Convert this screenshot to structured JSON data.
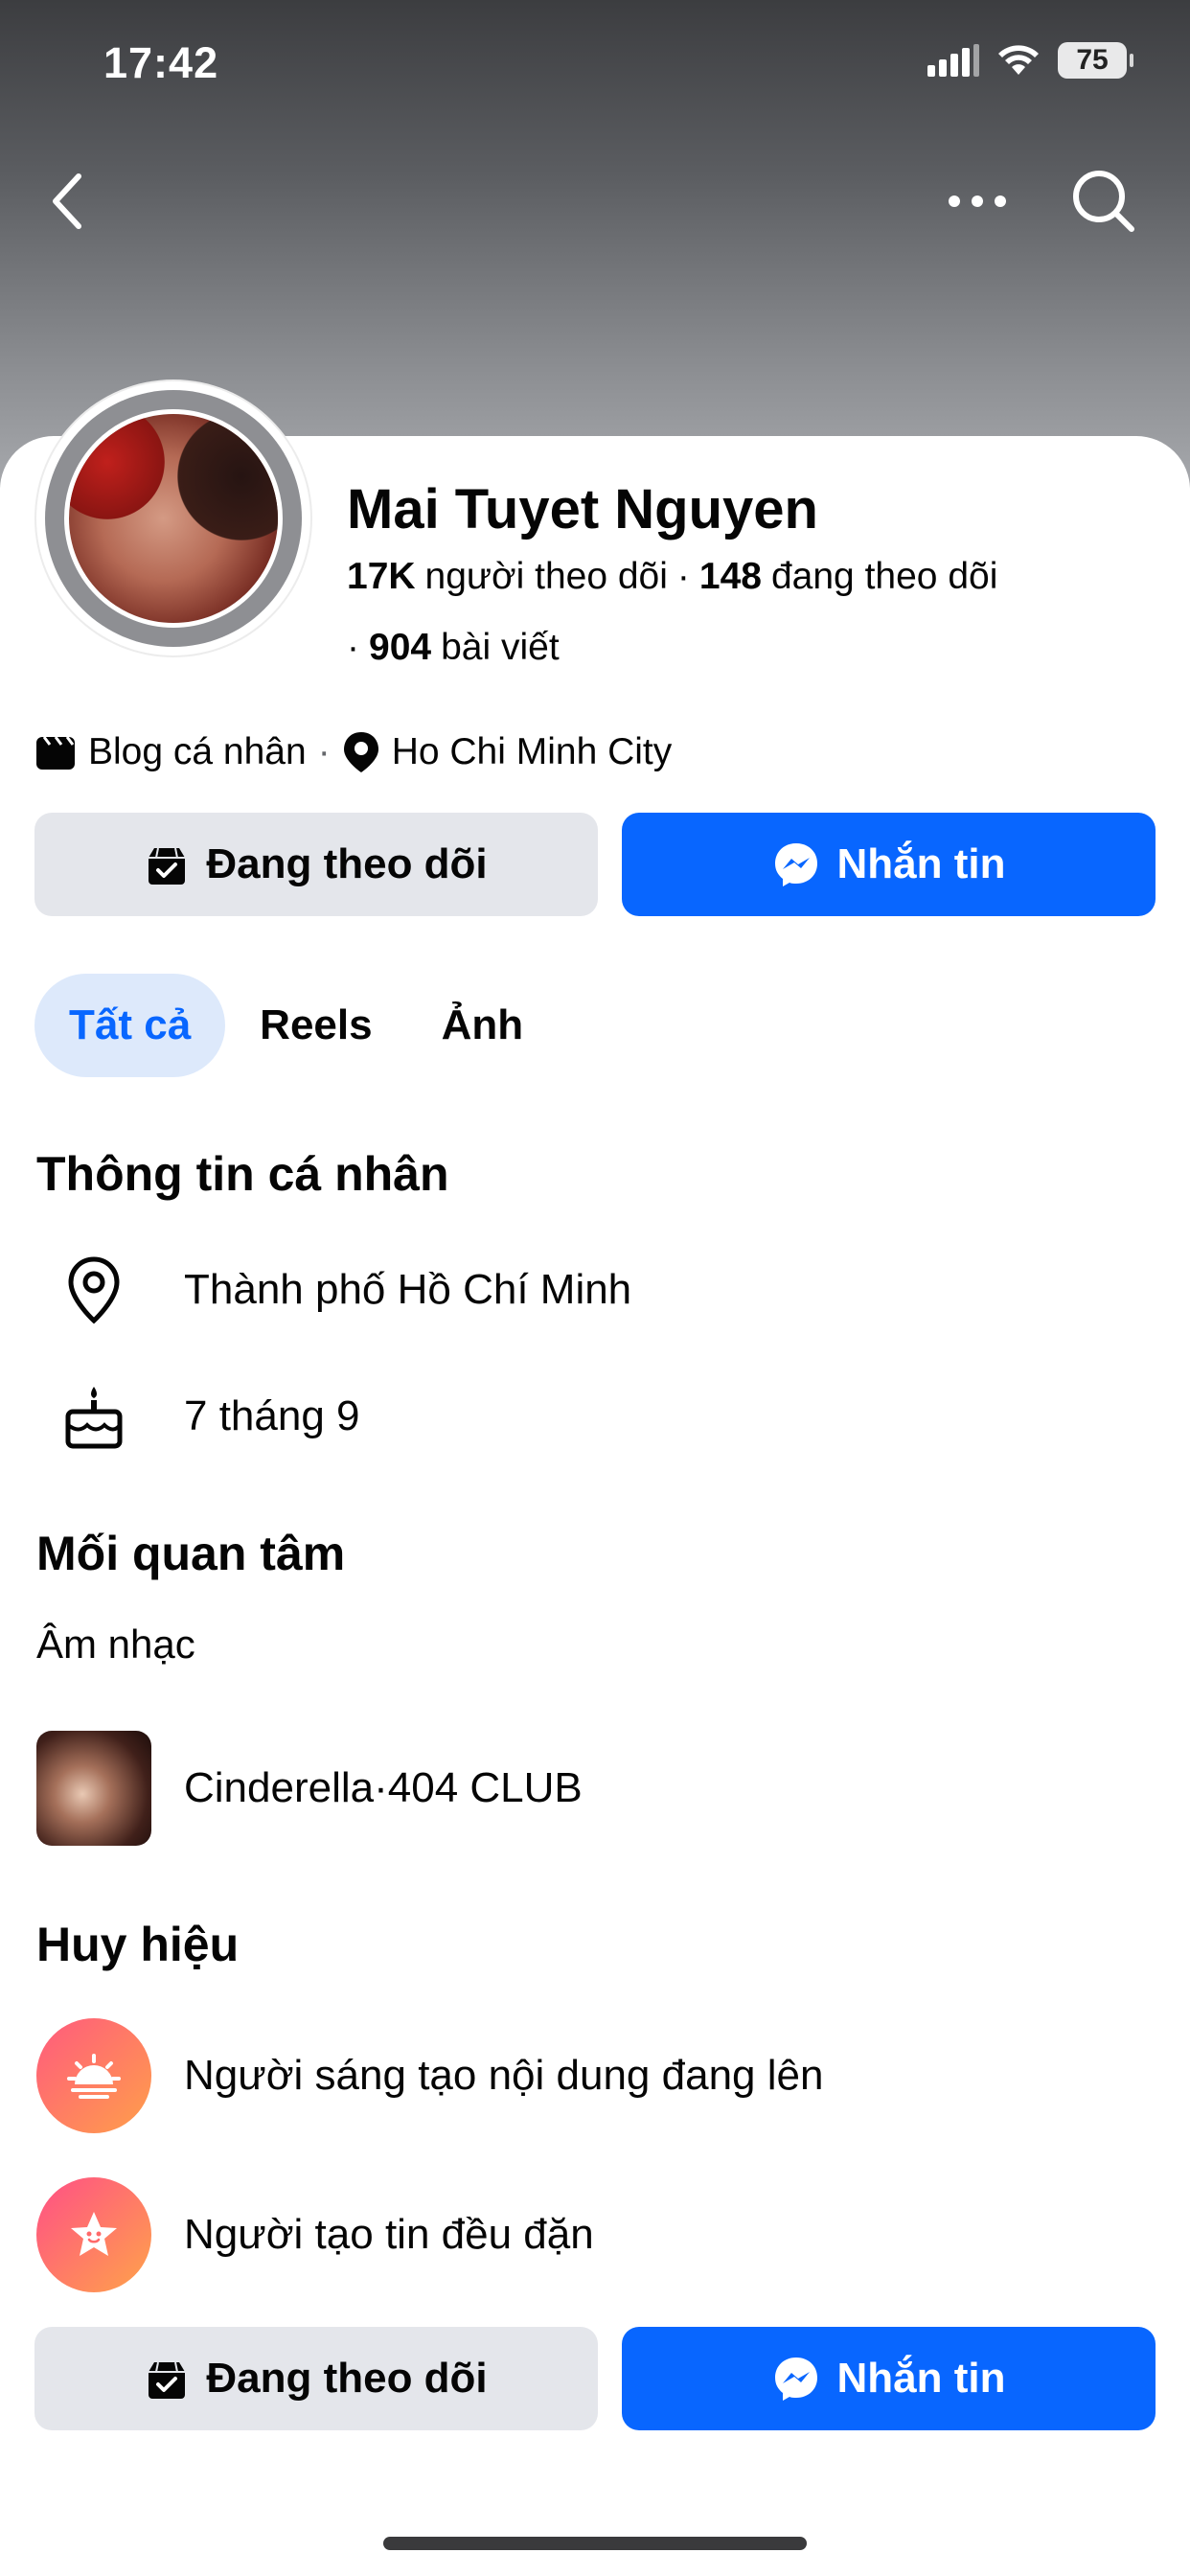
{
  "status_bar": {
    "time": "17:42",
    "battery": "75"
  },
  "profile": {
    "name": "Mai Tuyet Nguyen",
    "followers_count": "17K",
    "followers_label": "người theo dõi",
    "separator": "·",
    "following_count": "148",
    "following_label": "đang theo dõi",
    "posts_count": "904",
    "posts_label": "bài viết"
  },
  "meta": {
    "category": "Blog cá nhân",
    "location": "Ho Chi Minh City"
  },
  "actions": {
    "following_label": "Đang theo dõi",
    "message_label": "Nhắn tin"
  },
  "tabs": [
    {
      "label": "Tất cả",
      "active": true
    },
    {
      "label": "Reels",
      "active": false
    },
    {
      "label": "Ảnh",
      "active": false
    }
  ],
  "personal_info": {
    "title": "Thông tin cá nhân",
    "items": [
      {
        "icon": "location-pin-icon",
        "text": "Thành phố Hồ Chí Minh"
      },
      {
        "icon": "birthday-cake-icon",
        "text": "7 tháng 9"
      }
    ]
  },
  "interests": {
    "title": "Mối quan tâm",
    "category": "Âm nhạc",
    "items": [
      {
        "text": "Cinderella·404 CLUB"
      }
    ]
  },
  "badges": {
    "title": "Huy hiệu",
    "items": [
      {
        "icon": "sunrise-icon",
        "text": "Người sáng tạo nội dung đang lên",
        "color_from": "#ff5a7e",
        "color_to": "#ff9f4a"
      },
      {
        "icon": "star-face-icon",
        "text": "Người tạo tin đều đặn",
        "color_from": "#ff4f86",
        "color_to": "#ffa34a"
      }
    ]
  },
  "colors": {
    "accent": "#0866ff",
    "button_gray": "#e4e6eb",
    "tab_active_bg": "#dde9fb"
  }
}
